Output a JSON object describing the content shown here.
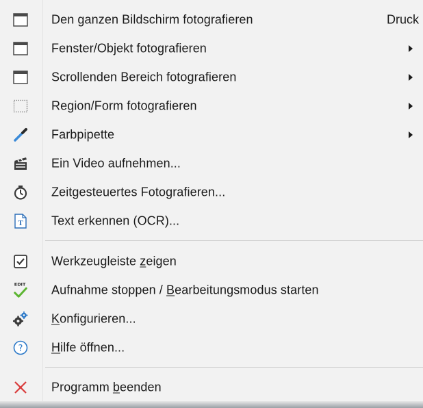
{
  "menu": {
    "items": [
      {
        "label": "Den ganzen Bildschirm fotografieren",
        "shortcut": "Druck",
        "icon": "window-icon"
      },
      {
        "label": "Fenster/Objekt fotografieren",
        "submenu": true,
        "icon": "window-icon"
      },
      {
        "label": "Scrollenden Bereich fotografieren",
        "submenu": true,
        "icon": "window-icon"
      },
      {
        "label": "Region/Form fotografieren",
        "submenu": true,
        "icon": "dotted-region-icon"
      },
      {
        "label": "Farbpipette",
        "submenu": true,
        "icon": "eyedropper-icon"
      },
      {
        "label": "Ein Video aufnehmen...",
        "icon": "clapperboard-icon"
      },
      {
        "label": "Zeitgesteuertes Fotografieren...",
        "icon": "stopwatch-icon"
      },
      {
        "label": "Text erkennen (OCR)...",
        "icon": "text-document-icon"
      }
    ],
    "items2": [
      {
        "pre": "Werkzeugleiste ",
        "u": "z",
        "post": "eigen",
        "icon": "checkbox-icon"
      },
      {
        "pre": "Aufnahme stoppen / ",
        "u": "B",
        "post": "earbeitungsmodus starten",
        "icon": "edit-check-icon",
        "icon_text": "EDIT"
      },
      {
        "pre": "",
        "u": "K",
        "post": "onfigurieren...",
        "icon": "gears-icon"
      },
      {
        "pre": "",
        "u": "H",
        "post": "ilfe öffnen...",
        "icon": "help-icon"
      }
    ],
    "items3": [
      {
        "pre": "Programm ",
        "u": "b",
        "post": "eenden",
        "icon": "close-x-icon"
      }
    ]
  },
  "colors": {
    "background": "#f2f2f2",
    "separator": "#cfcfcf",
    "icon_blue": "#1e73be",
    "check_green": "#5cb531",
    "close_red": "#d93a3a"
  }
}
